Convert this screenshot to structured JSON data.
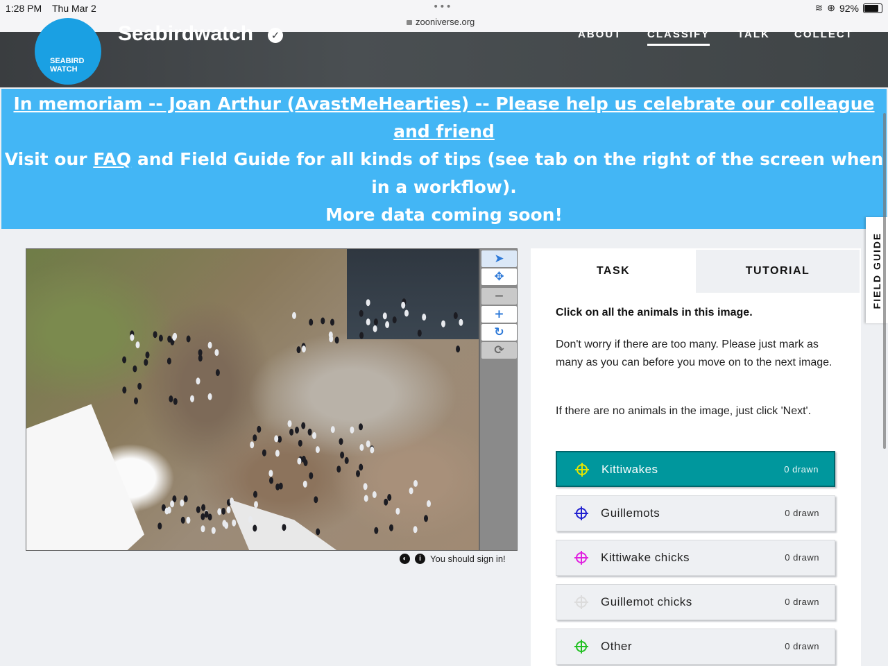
{
  "status_bar": {
    "time": "1:28 PM",
    "date": "Thu Mar 2",
    "url": "zooniverse.org",
    "battery": "92%",
    "battery_level": 0.92
  },
  "header": {
    "logo_text": "SEABIRD WATCH",
    "title": "Seabirdwatch",
    "nav": [
      {
        "label": "ABOUT",
        "active": false
      },
      {
        "label": "CLASSIFY",
        "active": true
      },
      {
        "label": "TALK",
        "active": false
      },
      {
        "label": "COLLECT",
        "active": false
      }
    ]
  },
  "banner": {
    "memoriam_link": "In memoriam -- Joan Arthur (AvastMeHearties) -- Please help us celebrate our colleague and friend",
    "visit_prefix": "Visit our ",
    "faq_link": "FAQ",
    "visit_suffix": " and Field Guide for all kinds of tips (see tab on the right of the screen when in a workflow).",
    "more_data": "More data coming soon!"
  },
  "viewer": {
    "tools": [
      {
        "icon": "pointer-icon",
        "glyph": "➤"
      },
      {
        "icon": "move-icon",
        "glyph": "✥"
      },
      {
        "icon": "zoom-out-icon",
        "glyph": "−"
      },
      {
        "icon": "zoom-in-icon",
        "glyph": "+"
      },
      {
        "icon": "rotate-icon",
        "glyph": "↻"
      },
      {
        "icon": "reset-icon",
        "glyph": "⟳"
      }
    ],
    "sign_in_text": "You should sign in!"
  },
  "task_panel": {
    "tabs": {
      "task": "TASK",
      "tutorial": "TUTORIAL"
    },
    "question": "Click on all the animals in this image.",
    "help1": "Don't worry if there are too many. Please just mark as many as you can before you move on to the next image.",
    "help2": "If there are no animals in the image, just click 'Next'.",
    "choices": [
      {
        "label": "Kittiwakes",
        "count": "0 drawn",
        "color": "#e6e600",
        "active": true
      },
      {
        "label": "Guillemots",
        "count": "0 drawn",
        "color": "#2020d0",
        "active": false
      },
      {
        "label": "Kittiwake chicks",
        "count": "0 drawn",
        "color": "#e020e0",
        "active": false
      },
      {
        "label": "Guillemot chicks",
        "count": "0 drawn",
        "color": "#e0e0e0",
        "active": false
      },
      {
        "label": "Other",
        "count": "0 drawn",
        "color": "#20c020",
        "active": false
      }
    ]
  },
  "field_guide": "FIELD GUIDE"
}
